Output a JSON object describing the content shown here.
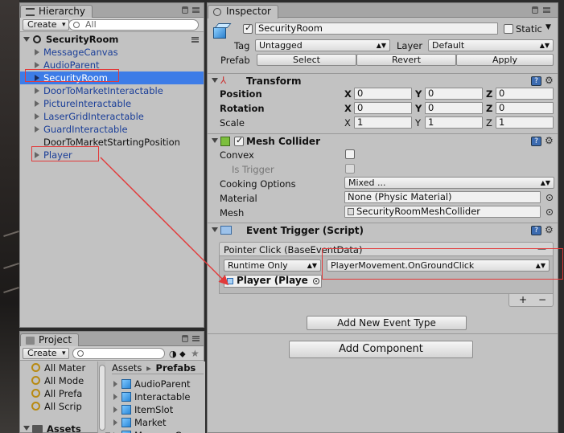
{
  "hierarchy": {
    "tab": "Hierarchy",
    "create_label": "Create",
    "search_placeholder": "All",
    "scene": "SecurityRoom",
    "items": [
      {
        "label": "MessageCanvas",
        "prefab": true,
        "expandable": true
      },
      {
        "label": "AudioParent",
        "prefab": true,
        "expandable": true
      },
      {
        "label": "SecurityRoom",
        "prefab": true,
        "expandable": true,
        "selected": true
      },
      {
        "label": "DoorToMarketInteractable",
        "prefab": true,
        "expandable": true
      },
      {
        "label": "PictureInteractable",
        "prefab": true,
        "expandable": true
      },
      {
        "label": "LaserGridInteractable",
        "prefab": true,
        "expandable": true
      },
      {
        "label": "GuardInteractable",
        "prefab": true,
        "expandable": true
      },
      {
        "label": "DoorToMarketStartingPosition",
        "prefab": false,
        "expandable": false
      },
      {
        "label": "Player",
        "prefab": true,
        "expandable": true
      }
    ]
  },
  "project": {
    "tab": "Project",
    "create_label": "Create",
    "favorites": [
      "All Mater",
      "All Mode",
      "All Prefa",
      "All Scrip"
    ],
    "assets_label": "Assets",
    "breadcrumb": {
      "root": "Assets",
      "sep": "▸",
      "current": "Prefabs"
    },
    "assets": [
      "AudioParent",
      "Interactable",
      "ItemSlot",
      "Market",
      "MessageCanva"
    ]
  },
  "inspector": {
    "tab": "Inspector",
    "object_name": "SecurityRoom",
    "static_label": "Static",
    "tag_label": "Tag",
    "tag_value": "Untagged",
    "layer_label": "Layer",
    "layer_value": "Default",
    "prefab_label": "Prefab",
    "prefab_buttons": [
      "Select",
      "Revert",
      "Apply"
    ],
    "transform": {
      "title": "Transform",
      "rows": [
        {
          "label": "Position",
          "x": "0",
          "y": "0",
          "z": "0",
          "bold": true
        },
        {
          "label": "Rotation",
          "x": "0",
          "y": "0",
          "z": "0",
          "bold": true
        },
        {
          "label": "Scale",
          "x": "1",
          "y": "1",
          "z": "1",
          "bold": false
        }
      ],
      "axis": [
        "X",
        "Y",
        "Z"
      ]
    },
    "mesh_collider": {
      "title": "Mesh Collider",
      "convex_label": "Convex",
      "is_trigger_label": "Is Trigger",
      "cooking_label": "Cooking Options",
      "cooking_value": "Mixed ...",
      "material_label": "Material",
      "material_value": "None (Physic Material)",
      "mesh_label": "Mesh",
      "mesh_value": "SecurityRoomMeshCollider"
    },
    "event_trigger": {
      "title": "Event Trigger (Script)",
      "entry_header": "Pointer Click (BaseEventData)",
      "remove": "—",
      "runtime_value": "Runtime Only",
      "function_value": "PlayerMovement.OnGroundClick",
      "object_value": "Player (Playe",
      "plus": "+",
      "minus": "−",
      "add_event_label": "Add New Event Type"
    },
    "add_component_label": "Add Component"
  }
}
